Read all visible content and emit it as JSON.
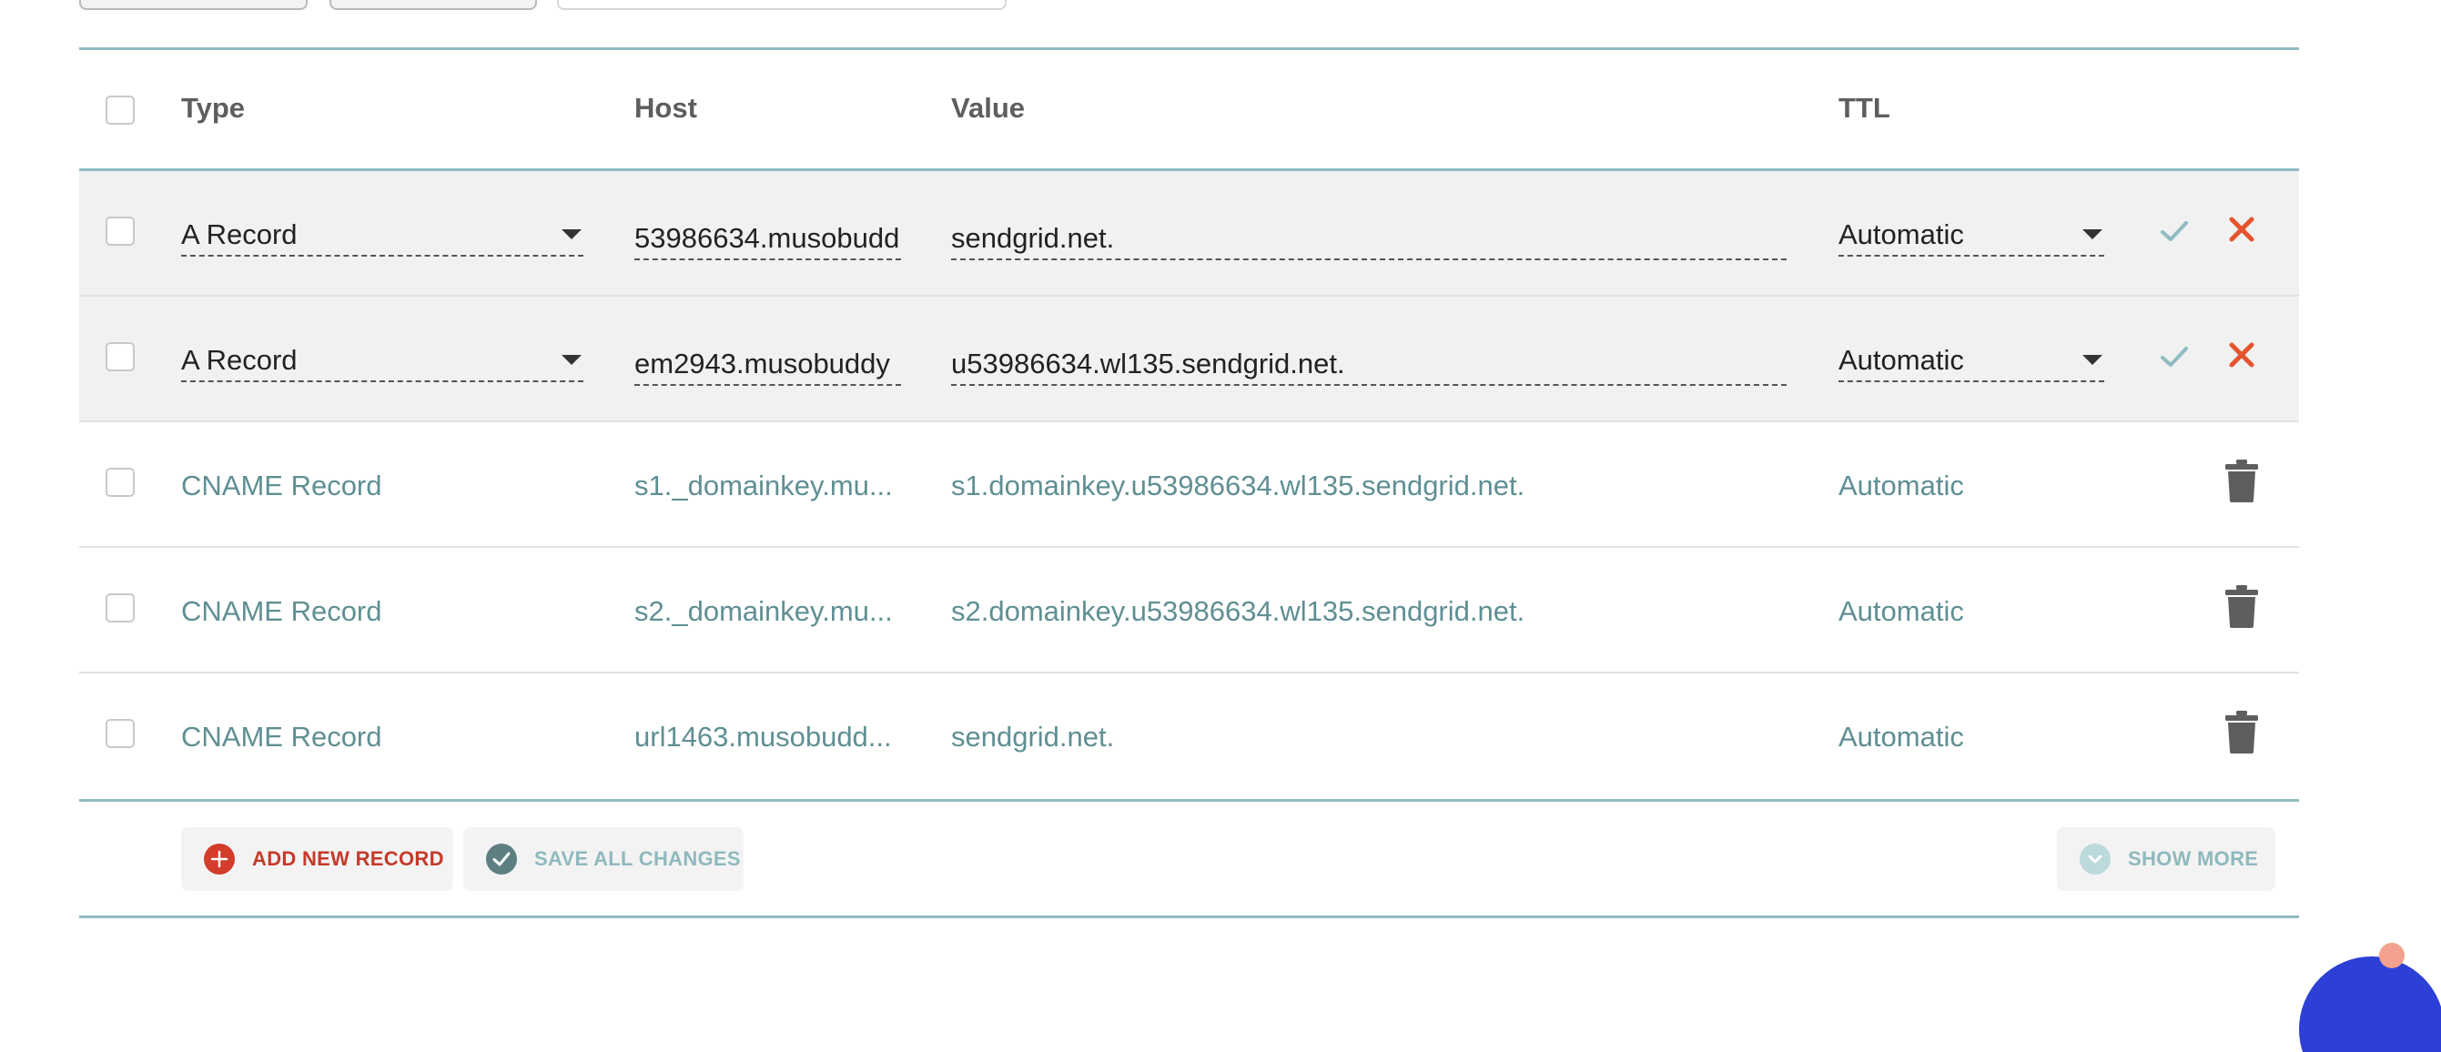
{
  "colors": {
    "accent_line": "#8fbcc1",
    "link_text": "#5f8f93",
    "danger": "#e5542e",
    "confirm": "#8fbcc1",
    "add_red": "#c53a2a"
  },
  "table": {
    "headers": {
      "type": "Type",
      "host": "Host",
      "value": "Value",
      "ttl": "TTL"
    },
    "editing_rows": [
      {
        "type": "A Record",
        "host": "53986634.musobudd",
        "value": "sendgrid.net.",
        "ttl": "Automatic"
      },
      {
        "type": "A Record",
        "host": "em2943.musobuddy",
        "value": "u53986634.wl135.sendgrid.net.",
        "ttl": "Automatic"
      }
    ],
    "rows": [
      {
        "type": "CNAME Record",
        "host": "s1._domainkey.mu...",
        "value": "s1.domainkey.u53986634.wl135.sendgrid.net.",
        "ttl": "Automatic"
      },
      {
        "type": "CNAME Record",
        "host": "s2._domainkey.mu...",
        "value": "s2.domainkey.u53986634.wl135.sendgrid.net.",
        "ttl": "Automatic"
      },
      {
        "type": "CNAME Record",
        "host": "url1463.musobudd...",
        "value": "sendgrid.net.",
        "ttl": "Automatic"
      }
    ]
  },
  "footer": {
    "add_label": "ADD NEW RECORD",
    "save_label": "SAVE ALL CHANGES",
    "more_label": "SHOW MORE"
  }
}
